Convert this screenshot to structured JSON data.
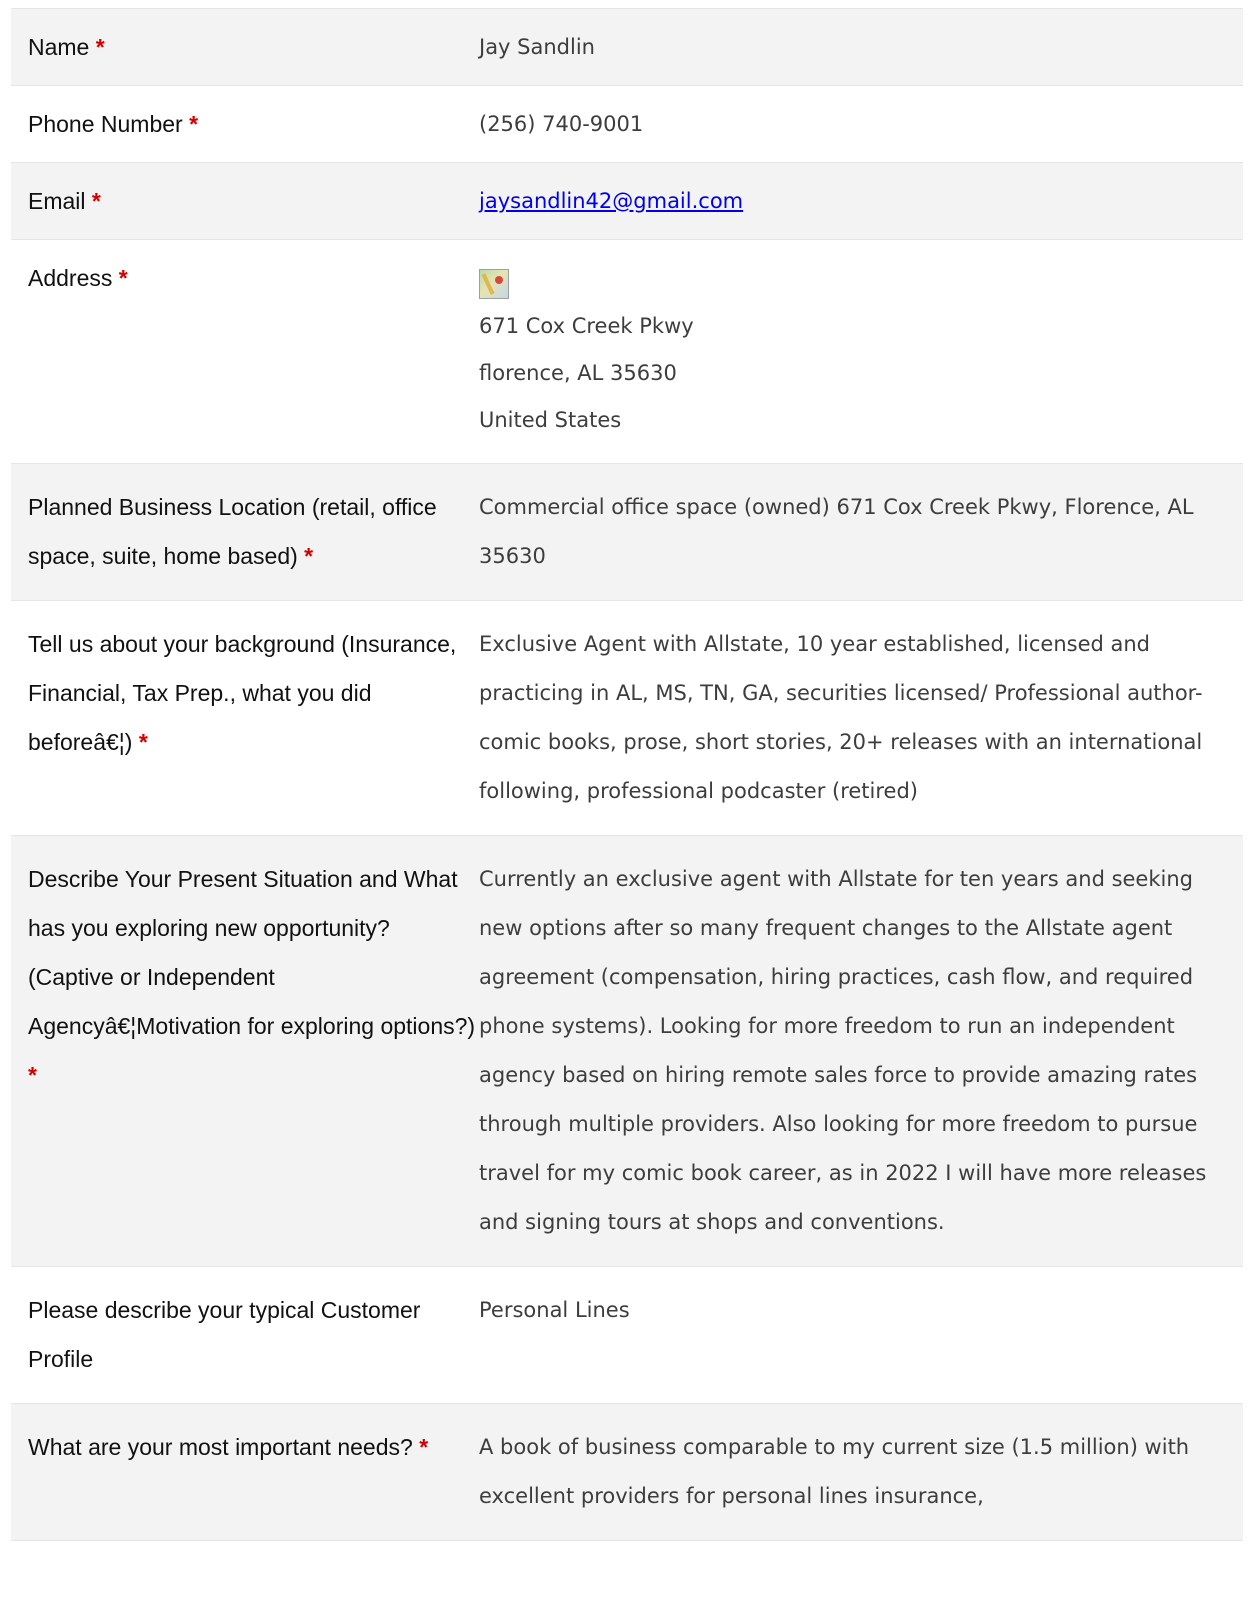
{
  "required_mark": "*",
  "fields": {
    "name": {
      "label": "Name",
      "value": "Jay Sandlin"
    },
    "phone": {
      "label": "Phone Number",
      "value": "(256) 740-9001"
    },
    "email": {
      "label": "Email",
      "value": "jaysandlin42@gmail.com"
    },
    "address": {
      "label": "Address",
      "line1": "671 Cox Creek Pkwy",
      "line2": "florence, AL 35630",
      "line3": "United States"
    },
    "location": {
      "label": "Planned Business Location (retail, office space, suite, home based)",
      "value": "Commercial office space (owned) 671 Cox Creek Pkwy, Florence, AL 35630"
    },
    "background": {
      "label": "Tell us about your background (Insurance, Financial, Tax Prep., what you did beforeâ€¦)",
      "value": "Exclusive Agent with Allstate, 10 year established, licensed and practicing in AL, MS, TN, GA, securities licensed/ Professional author- comic books, prose, short stories, 20+ releases with an international following, professional podcaster (retired)"
    },
    "situation": {
      "label": "Describe Your Present Situation and What has you exploring new opportunity? (Captive or Independent Agencyâ€¦Motivation for exploring options?)",
      "value": "Currently an exclusive agent with Allstate for ten years and seeking new options after so many frequent changes to the Allstate agent agreement (compensation, hiring practices, cash flow, and required phone systems). Looking for more freedom to run an independent agency based on hiring remote sales force to provide amazing rates through multiple providers. Also looking for more freedom to pursue travel for my comic book career, as in 2022 I will have more releases and signing tours at shops and conventions."
    },
    "customer_profile": {
      "label": "Please describe your typical Customer Profile",
      "value": "Personal Lines"
    },
    "needs": {
      "label": "What are your most important needs?",
      "value": "A book of business comparable to my current size (1.5 million) with excellent providers for personal lines insurance,"
    }
  },
  "icons": {
    "address_map": "map-icon"
  }
}
